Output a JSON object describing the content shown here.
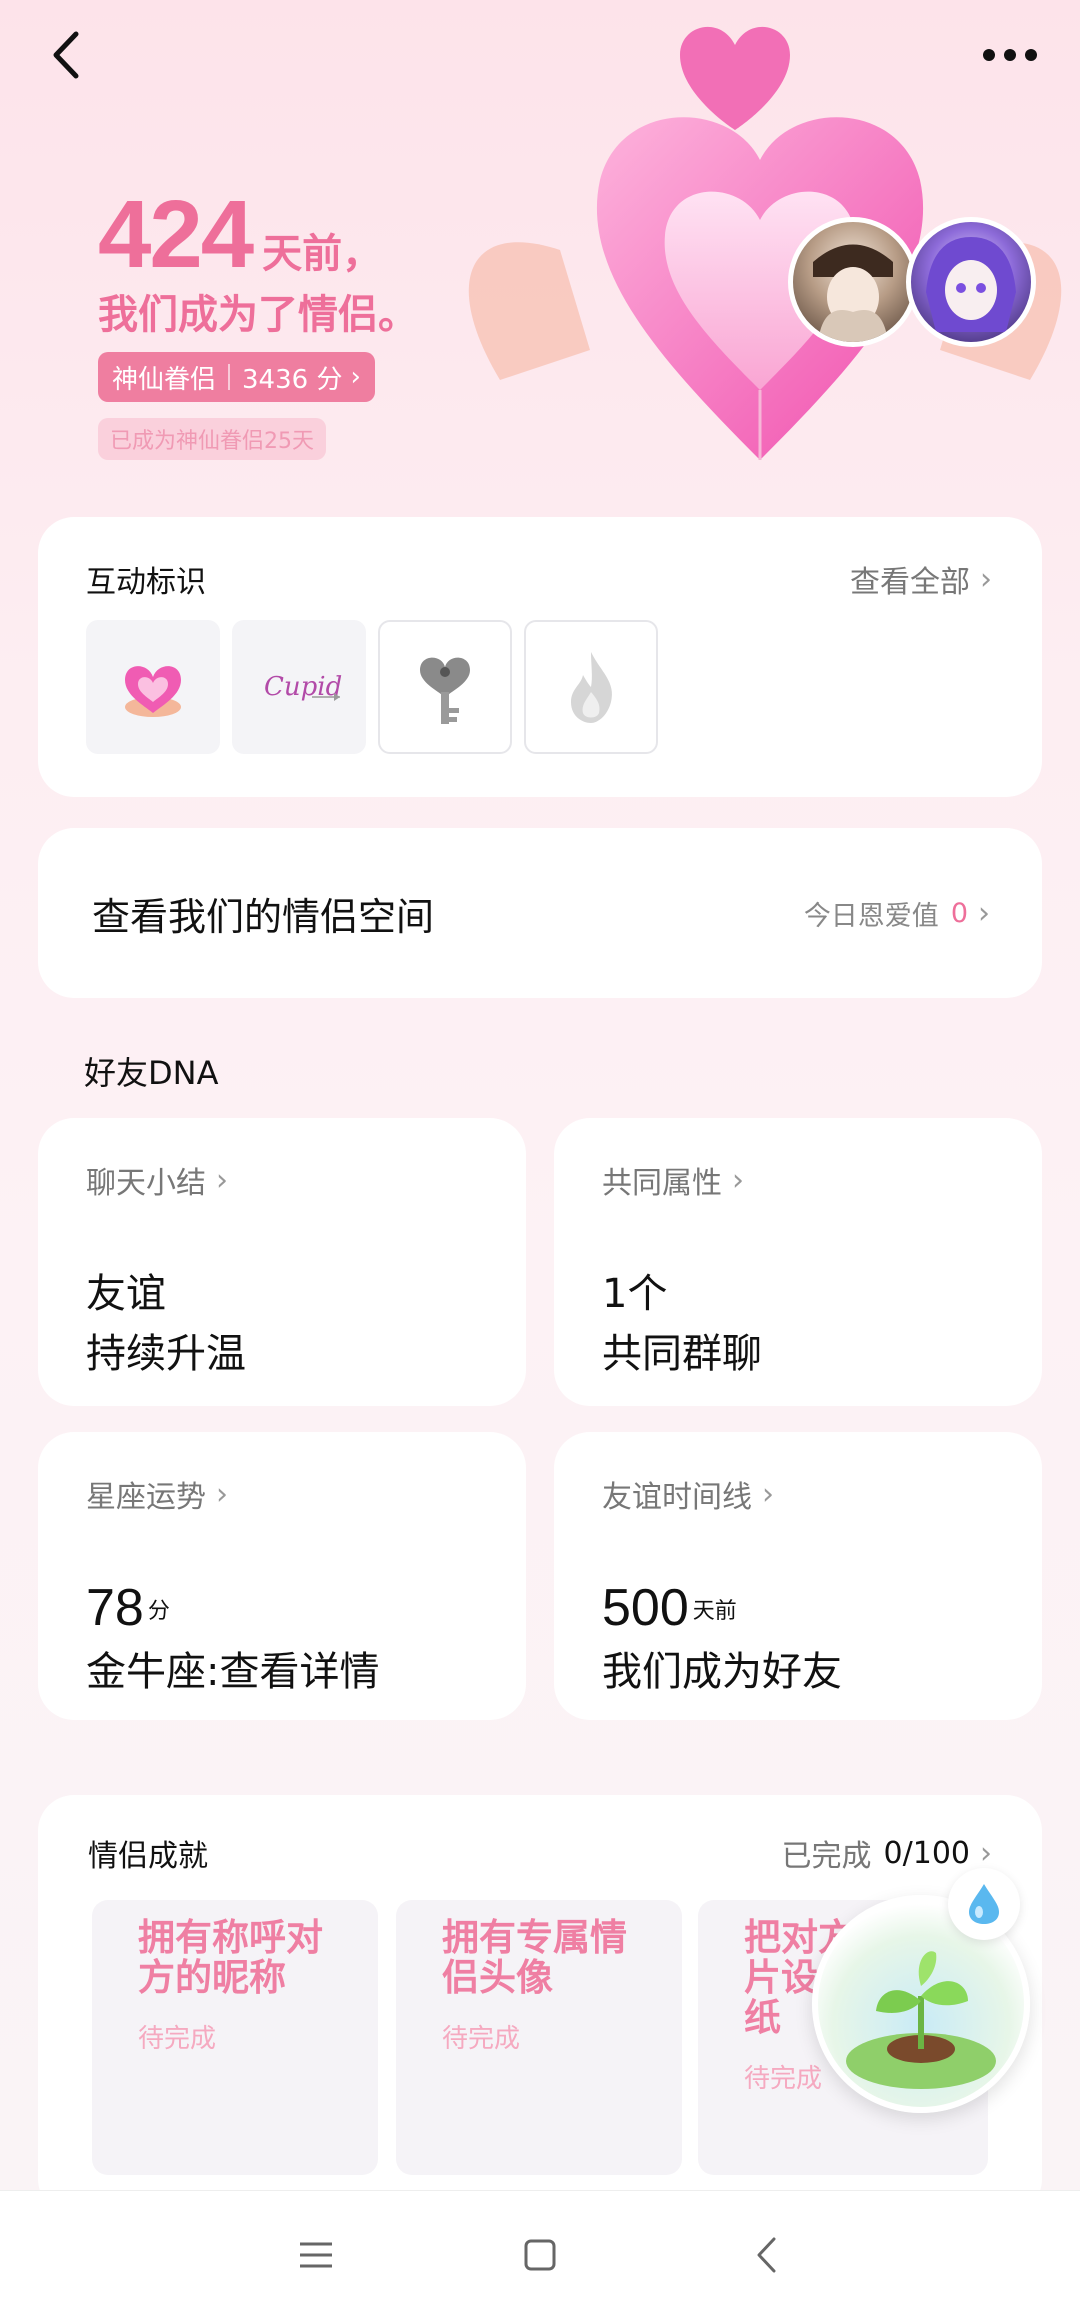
{
  "header": {
    "back_icon": "chevron-left-icon",
    "more_icon": "more-horizontal-icon"
  },
  "hero": {
    "days": "424",
    "days_unit": "天前，",
    "subtitle": "我们成为了情侣。",
    "level_name": "神仙眷侣",
    "level_score": "3436 分",
    "since_text": "已成为神仙眷侣25天"
  },
  "interaction_badges": {
    "title": "互动标识",
    "view_all": "查看全部",
    "badges": [
      {
        "icon": "pink-heart-gem-icon"
      },
      {
        "icon": "cupid-script-icon",
        "text": "Cupid"
      },
      {
        "icon": "heart-key-icon"
      },
      {
        "icon": "flame-icon"
      }
    ]
  },
  "couple_space": {
    "title": "查看我们的情侣空间",
    "today_label": "今日恩爱值",
    "today_value": "0"
  },
  "dna": {
    "section_title": "好友DNA",
    "cards": [
      {
        "head": "聊天小结",
        "line1": "友谊",
        "line2": "持续升温"
      },
      {
        "head": "共同属性",
        "line1": "1个",
        "line2": "共同群聊"
      },
      {
        "head": "星座运势",
        "num": "78",
        "num_unit": "分",
        "line2": "金牛座:查看详情"
      },
      {
        "head": "友谊时间线",
        "num": "500",
        "num_unit": "天前",
        "line2": "我们成为好友"
      }
    ]
  },
  "achievements": {
    "title": "情侣成就",
    "progress_label": "已完成",
    "progress_value": "0/100",
    "items": [
      {
        "text": "拥有称呼对方的昵称",
        "status": "待完成"
      },
      {
        "text": "拥有专属情侣头像",
        "status": "待完成"
      },
      {
        "text": "把对方的照片设置为壁纸",
        "status": "待完成"
      }
    ]
  },
  "nav": {
    "menu_icon": "menu-icon",
    "home_icon": "square-home-icon",
    "back_icon": "triangle-back-icon"
  },
  "colors": {
    "accent": "#ee6f9a",
    "badge_bg": "#ef7ea0",
    "background": "#fde3ea"
  }
}
